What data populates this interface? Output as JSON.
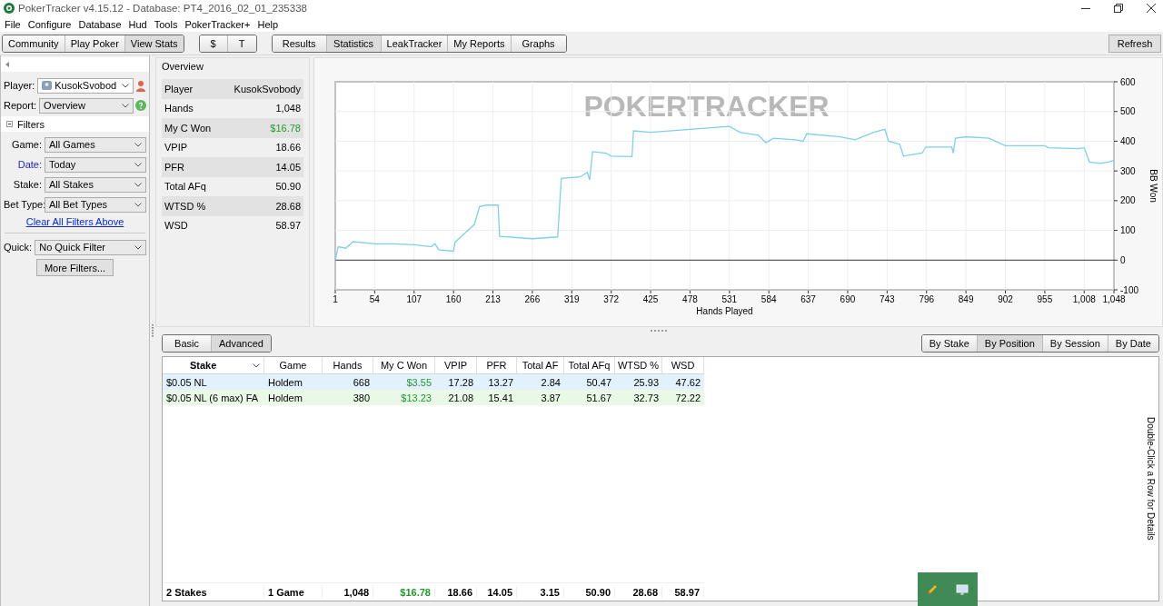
{
  "window": {
    "title": "PokerTracker v4.15.12 - Database: PT4_2016_02_01_235338"
  },
  "menu": [
    "File",
    "Configure",
    "Database",
    "Hud",
    "Tools",
    "PokerTracker+",
    "Help"
  ],
  "toolbar": {
    "groups": [
      {
        "buttons": [
          {
            "label": "Community",
            "selected": false
          },
          {
            "label": "Play Poker",
            "selected": false
          },
          {
            "label": "View Stats",
            "selected": true
          }
        ]
      },
      {
        "buttons": [
          {
            "label": "$",
            "selected": false
          },
          {
            "label": "T",
            "selected": false
          }
        ]
      },
      {
        "buttons": [
          {
            "label": "Results",
            "selected": false
          },
          {
            "label": "Statistics",
            "selected": true
          },
          {
            "label": "LeakTracker",
            "selected": false
          },
          {
            "label": "My Reports",
            "selected": false
          },
          {
            "label": "Graphs",
            "selected": false
          }
        ]
      }
    ],
    "refresh": "Refresh"
  },
  "left_panel": {
    "player": {
      "label": "Player:",
      "value": "KusokSvobod"
    },
    "report": {
      "label": "Report:",
      "value": "Overview"
    },
    "filters": {
      "title": "Filters",
      "expanded": true,
      "items": [
        {
          "label": "Game:",
          "value": "All Games",
          "active": false
        },
        {
          "label": "Date:",
          "value": "Today",
          "active": true
        },
        {
          "label": "Stake:",
          "value": "All Stakes",
          "active": false
        },
        {
          "label": "Bet Type:",
          "value": "All Bet Types",
          "active": false
        }
      ],
      "clear_link": "Clear All Filters Above",
      "quick": {
        "label": "Quick:",
        "value": "No Quick Filter"
      },
      "more_button": "More Filters..."
    }
  },
  "overview": {
    "title": "Overview",
    "rows": [
      {
        "label": "Player",
        "value": "KusokSvobody",
        "kind": "text"
      },
      {
        "label": "Hands",
        "value": "1,048",
        "kind": "text"
      },
      {
        "label": "My C Won",
        "value": "$16.78",
        "kind": "money"
      },
      {
        "label": "VPIP",
        "value": "18.66",
        "kind": "text"
      },
      {
        "label": "PFR",
        "value": "14.05",
        "kind": "text"
      },
      {
        "label": "Total AFq",
        "value": "50.90",
        "kind": "text"
      },
      {
        "label": "WTSD %",
        "value": "28.68",
        "kind": "text"
      },
      {
        "label": "WSD",
        "value": "58.97",
        "kind": "text"
      }
    ]
  },
  "chart": {
    "watermark": "POKERTRACKER",
    "chart_data": {
      "type": "line",
      "xlabel": "Hands Played",
      "ylabel": "BB Won",
      "x": [
        1,
        5,
        15,
        25,
        54,
        80,
        107,
        130,
        135,
        140,
        160,
        162,
        175,
        188,
        195,
        205,
        220,
        222,
        266,
        300,
        305,
        330,
        340,
        343,
        347,
        365,
        372,
        400,
        402,
        425,
        478,
        531,
        545,
        570,
        580,
        590,
        620,
        630,
        635,
        680,
        700,
        725,
        740,
        745,
        760,
        765,
        790,
        795,
        830,
        832,
        835,
        849,
        880,
        902,
        955,
        960,
        1000,
        1008,
        1015,
        1030,
        1040,
        1048
      ],
      "series": [
        {
          "color": "#7fcfee",
          "values": [
            0,
            45,
            40,
            62,
            55,
            55,
            52,
            45,
            55,
            35,
            30,
            60,
            90,
            120,
            180,
            185,
            185,
            80,
            72,
            78,
            275,
            280,
            295,
            270,
            365,
            360,
            350,
            348,
            435,
            430,
            440,
            450,
            430,
            420,
            395,
            410,
            405,
            400,
            425,
            415,
            405,
            430,
            440,
            400,
            390,
            350,
            360,
            380,
            380,
            360,
            410,
            415,
            410,
            385,
            385,
            378,
            375,
            378,
            330,
            325,
            330,
            335
          ]
        }
      ],
      "grid": true,
      "xlim": [
        1,
        1048
      ],
      "ylim": [
        -100,
        600
      ],
      "xticks": [
        1,
        54,
        107,
        160,
        213,
        266,
        319,
        372,
        425,
        478,
        531,
        584,
        637,
        690,
        743,
        796,
        849,
        902,
        955,
        {
          "value": 1008,
          "label": "1,008"
        },
        {
          "value": 1048,
          "label": "1,048"
        }
      ],
      "yticks": [
        -100,
        0,
        100,
        200,
        300,
        400,
        500,
        600
      ]
    }
  },
  "report_tabs": [
    {
      "label": "Basic",
      "selected": false
    },
    {
      "label": "Advanced",
      "selected": true
    }
  ],
  "group_tabs": [
    {
      "label": "By Stake",
      "selected": false
    },
    {
      "label": "By Position",
      "selected": true
    },
    {
      "label": "By Session",
      "selected": false
    },
    {
      "label": "By Date",
      "selected": false
    }
  ],
  "table": {
    "columns": [
      {
        "label": "Stake",
        "sorted": true,
        "kind": "text"
      },
      {
        "label": "Game",
        "sorted": false,
        "kind": "text"
      },
      {
        "label": "Hands",
        "sorted": false,
        "kind": "number"
      },
      {
        "label": "My C Won",
        "sorted": false,
        "kind": "money"
      },
      {
        "label": "VPIP",
        "sorted": false,
        "kind": "number"
      },
      {
        "label": "PFR",
        "sorted": false,
        "kind": "number"
      },
      {
        "label": "Total AF",
        "sorted": false,
        "kind": "number"
      },
      {
        "label": "Total AFq",
        "sorted": false,
        "kind": "number"
      },
      {
        "label": "WTSD %",
        "sorted": false,
        "kind": "number"
      },
      {
        "label": "WSD",
        "sorted": false,
        "kind": "number"
      }
    ],
    "rows": [
      {
        "selected": true,
        "cells": [
          "$0.05 NL",
          "Holdem",
          "668",
          "$3.55",
          "17.28",
          "13.27",
          "2.84",
          "50.47",
          "25.93",
          "47.62"
        ]
      },
      {
        "selected": false,
        "cells": [
          "$0.05 NL (6 max) FA",
          "Holdem",
          "380",
          "$13.23",
          "21.08",
          "15.41",
          "3.87",
          "51.67",
          "32.73",
          "72.22"
        ]
      }
    ],
    "totals": [
      "2 Stakes",
      "1 Game",
      "1,048",
      "$16.78",
      "18.66",
      "14.05",
      "3.15",
      "50.90",
      "28.68",
      "58.97"
    ]
  },
  "hint": "Double-Click a Row for Details"
}
